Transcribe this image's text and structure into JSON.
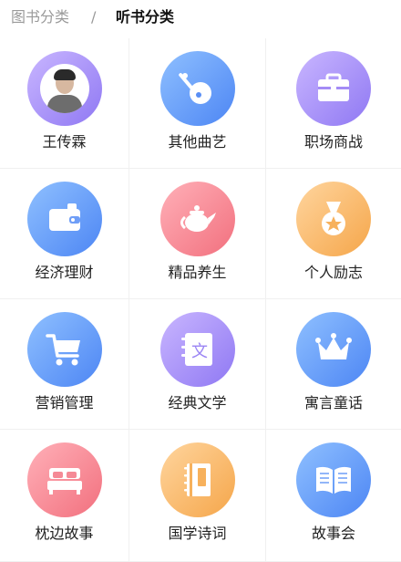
{
  "tabs": {
    "books": "图书分类",
    "separator": "/",
    "audio": "听书分类"
  },
  "categories": [
    {
      "label": "王传霖",
      "icon": "author-avatar",
      "color": "purple"
    },
    {
      "label": "其他曲艺",
      "icon": "pipa-icon",
      "color": "blue"
    },
    {
      "label": "职场商战",
      "icon": "briefcase-icon",
      "color": "purple"
    },
    {
      "label": "经济理财",
      "icon": "wallet-icon",
      "color": "blue"
    },
    {
      "label": "精品养生",
      "icon": "teapot-icon",
      "color": "pink"
    },
    {
      "label": "个人励志",
      "icon": "medal-icon",
      "color": "orange"
    },
    {
      "label": "营销管理",
      "icon": "cart-icon",
      "color": "blue"
    },
    {
      "label": "经典文学",
      "icon": "book-wen-icon",
      "color": "purple"
    },
    {
      "label": "寓言童话",
      "icon": "crown-icon",
      "color": "blue"
    },
    {
      "label": "枕边故事",
      "icon": "bed-icon",
      "color": "pink"
    },
    {
      "label": "国学诗词",
      "icon": "scroll-book-icon",
      "color": "orange"
    },
    {
      "label": "故事会",
      "icon": "open-book-icon",
      "color": "blue"
    }
  ],
  "icon_glyphs": {
    "book_wen": "文"
  }
}
